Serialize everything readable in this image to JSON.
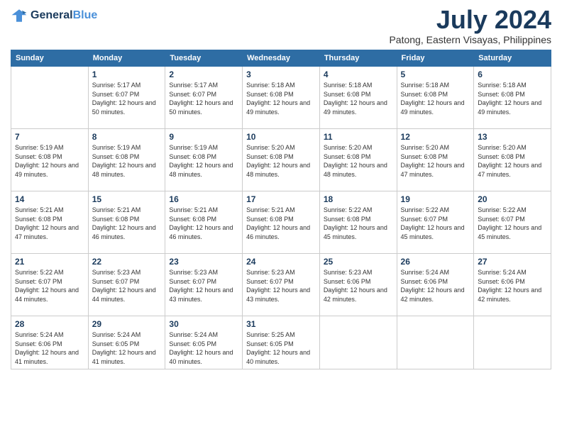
{
  "header": {
    "logo_line1": "General",
    "logo_line2": "Blue",
    "month": "July 2024",
    "location": "Patong, Eastern Visayas, Philippines"
  },
  "weekdays": [
    "Sunday",
    "Monday",
    "Tuesday",
    "Wednesday",
    "Thursday",
    "Friday",
    "Saturday"
  ],
  "weeks": [
    [
      {
        "day": "",
        "sunrise": "",
        "sunset": "",
        "daylight": ""
      },
      {
        "day": "1",
        "sunrise": "Sunrise: 5:17 AM",
        "sunset": "Sunset: 6:07 PM",
        "daylight": "Daylight: 12 hours and 50 minutes."
      },
      {
        "day": "2",
        "sunrise": "Sunrise: 5:17 AM",
        "sunset": "Sunset: 6:07 PM",
        "daylight": "Daylight: 12 hours and 50 minutes."
      },
      {
        "day": "3",
        "sunrise": "Sunrise: 5:18 AM",
        "sunset": "Sunset: 6:08 PM",
        "daylight": "Daylight: 12 hours and 49 minutes."
      },
      {
        "day": "4",
        "sunrise": "Sunrise: 5:18 AM",
        "sunset": "Sunset: 6:08 PM",
        "daylight": "Daylight: 12 hours and 49 minutes."
      },
      {
        "day": "5",
        "sunrise": "Sunrise: 5:18 AM",
        "sunset": "Sunset: 6:08 PM",
        "daylight": "Daylight: 12 hours and 49 minutes."
      },
      {
        "day": "6",
        "sunrise": "Sunrise: 5:18 AM",
        "sunset": "Sunset: 6:08 PM",
        "daylight": "Daylight: 12 hours and 49 minutes."
      }
    ],
    [
      {
        "day": "7",
        "sunrise": "Sunrise: 5:19 AM",
        "sunset": "Sunset: 6:08 PM",
        "daylight": "Daylight: 12 hours and 49 minutes."
      },
      {
        "day": "8",
        "sunrise": "Sunrise: 5:19 AM",
        "sunset": "Sunset: 6:08 PM",
        "daylight": "Daylight: 12 hours and 48 minutes."
      },
      {
        "day": "9",
        "sunrise": "Sunrise: 5:19 AM",
        "sunset": "Sunset: 6:08 PM",
        "daylight": "Daylight: 12 hours and 48 minutes."
      },
      {
        "day": "10",
        "sunrise": "Sunrise: 5:20 AM",
        "sunset": "Sunset: 6:08 PM",
        "daylight": "Daylight: 12 hours and 48 minutes."
      },
      {
        "day": "11",
        "sunrise": "Sunrise: 5:20 AM",
        "sunset": "Sunset: 6:08 PM",
        "daylight": "Daylight: 12 hours and 48 minutes."
      },
      {
        "day": "12",
        "sunrise": "Sunrise: 5:20 AM",
        "sunset": "Sunset: 6:08 PM",
        "daylight": "Daylight: 12 hours and 47 minutes."
      },
      {
        "day": "13",
        "sunrise": "Sunrise: 5:20 AM",
        "sunset": "Sunset: 6:08 PM",
        "daylight": "Daylight: 12 hours and 47 minutes."
      }
    ],
    [
      {
        "day": "14",
        "sunrise": "Sunrise: 5:21 AM",
        "sunset": "Sunset: 6:08 PM",
        "daylight": "Daylight: 12 hours and 47 minutes."
      },
      {
        "day": "15",
        "sunrise": "Sunrise: 5:21 AM",
        "sunset": "Sunset: 6:08 PM",
        "daylight": "Daylight: 12 hours and 46 minutes."
      },
      {
        "day": "16",
        "sunrise": "Sunrise: 5:21 AM",
        "sunset": "Sunset: 6:08 PM",
        "daylight": "Daylight: 12 hours and 46 minutes."
      },
      {
        "day": "17",
        "sunrise": "Sunrise: 5:21 AM",
        "sunset": "Sunset: 6:08 PM",
        "daylight": "Daylight: 12 hours and 46 minutes."
      },
      {
        "day": "18",
        "sunrise": "Sunrise: 5:22 AM",
        "sunset": "Sunset: 6:08 PM",
        "daylight": "Daylight: 12 hours and 45 minutes."
      },
      {
        "day": "19",
        "sunrise": "Sunrise: 5:22 AM",
        "sunset": "Sunset: 6:07 PM",
        "daylight": "Daylight: 12 hours and 45 minutes."
      },
      {
        "day": "20",
        "sunrise": "Sunrise: 5:22 AM",
        "sunset": "Sunset: 6:07 PM",
        "daylight": "Daylight: 12 hours and 45 minutes."
      }
    ],
    [
      {
        "day": "21",
        "sunrise": "Sunrise: 5:22 AM",
        "sunset": "Sunset: 6:07 PM",
        "daylight": "Daylight: 12 hours and 44 minutes."
      },
      {
        "day": "22",
        "sunrise": "Sunrise: 5:23 AM",
        "sunset": "Sunset: 6:07 PM",
        "daylight": "Daylight: 12 hours and 44 minutes."
      },
      {
        "day": "23",
        "sunrise": "Sunrise: 5:23 AM",
        "sunset": "Sunset: 6:07 PM",
        "daylight": "Daylight: 12 hours and 43 minutes."
      },
      {
        "day": "24",
        "sunrise": "Sunrise: 5:23 AM",
        "sunset": "Sunset: 6:07 PM",
        "daylight": "Daylight: 12 hours and 43 minutes."
      },
      {
        "day": "25",
        "sunrise": "Sunrise: 5:23 AM",
        "sunset": "Sunset: 6:06 PM",
        "daylight": "Daylight: 12 hours and 42 minutes."
      },
      {
        "day": "26",
        "sunrise": "Sunrise: 5:24 AM",
        "sunset": "Sunset: 6:06 PM",
        "daylight": "Daylight: 12 hours and 42 minutes."
      },
      {
        "day": "27",
        "sunrise": "Sunrise: 5:24 AM",
        "sunset": "Sunset: 6:06 PM",
        "daylight": "Daylight: 12 hours and 42 minutes."
      }
    ],
    [
      {
        "day": "28",
        "sunrise": "Sunrise: 5:24 AM",
        "sunset": "Sunset: 6:06 PM",
        "daylight": "Daylight: 12 hours and 41 minutes."
      },
      {
        "day": "29",
        "sunrise": "Sunrise: 5:24 AM",
        "sunset": "Sunset: 6:05 PM",
        "daylight": "Daylight: 12 hours and 41 minutes."
      },
      {
        "day": "30",
        "sunrise": "Sunrise: 5:24 AM",
        "sunset": "Sunset: 6:05 PM",
        "daylight": "Daylight: 12 hours and 40 minutes."
      },
      {
        "day": "31",
        "sunrise": "Sunrise: 5:25 AM",
        "sunset": "Sunset: 6:05 PM",
        "daylight": "Daylight: 12 hours and 40 minutes."
      },
      {
        "day": "",
        "sunrise": "",
        "sunset": "",
        "daylight": ""
      },
      {
        "day": "",
        "sunrise": "",
        "sunset": "",
        "daylight": ""
      },
      {
        "day": "",
        "sunrise": "",
        "sunset": "",
        "daylight": ""
      }
    ]
  ]
}
